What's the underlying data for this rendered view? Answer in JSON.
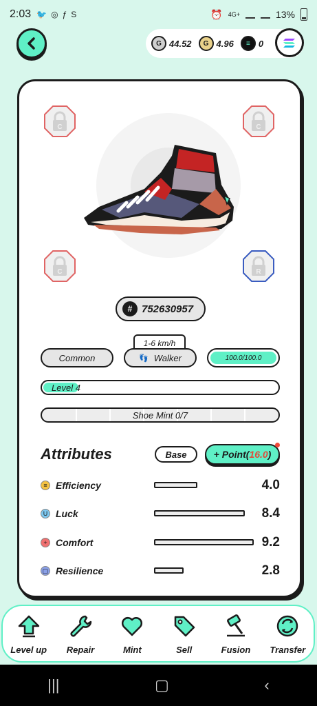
{
  "status_bar": {
    "time": "2:03",
    "battery": "13%",
    "network": "4G+"
  },
  "wallet": {
    "gst": "44.52",
    "gmt": "4.96",
    "sol": "0"
  },
  "sneaker": {
    "id": "752630957",
    "speed_range": "1-6 km/h",
    "rarity": "Common",
    "type": "Walker",
    "durability": "100.0/100.0",
    "level_label": "Level",
    "level": "4",
    "mint_label": "Shoe Mint 0/7",
    "mint_count": 0,
    "mint_max": 7,
    "level_progress": 0.15
  },
  "gem_slots": [
    {
      "name": "top-left",
      "letter": "C"
    },
    {
      "name": "top-right",
      "letter": "C"
    },
    {
      "name": "bottom-left",
      "letter": "C"
    },
    {
      "name": "bottom-right",
      "letter": "R"
    }
  ],
  "attributes": {
    "title": "Attributes",
    "base_label": "Base",
    "point_label": "+ Point(",
    "point_value": "16.0",
    "point_close": ")",
    "items": [
      {
        "name": "Efficiency",
        "icon": "efficiency-icon",
        "glyph": "≡",
        "color": "#f5c242",
        "value": "4.0",
        "fill": 0.19
      },
      {
        "name": "Luck",
        "icon": "luck-icon",
        "glyph": "U",
        "color": "#7ec8f0",
        "value": "8.4",
        "fill": 0.4
      },
      {
        "name": "Comfort",
        "icon": "comfort-icon",
        "glyph": "+",
        "color": "#f07070",
        "value": "9.2",
        "fill": 0.44
      },
      {
        "name": "Resilience",
        "icon": "resilience-icon",
        "glyph": "▢",
        "color": "#8aa0e8",
        "value": "2.8",
        "fill": 0.13
      }
    ]
  },
  "nav": [
    {
      "label": "Level up",
      "icon": "level-up-icon"
    },
    {
      "label": "Repair",
      "icon": "wrench-icon"
    },
    {
      "label": "Mint",
      "icon": "heart-icon"
    },
    {
      "label": "Sell",
      "icon": "tag-icon"
    },
    {
      "label": "Fusion",
      "icon": "hammer-icon"
    },
    {
      "label": "Transfer",
      "icon": "transfer-icon"
    }
  ],
  "colors": {
    "accent": "#5ff0c6",
    "background": "#d8f7ec",
    "outline": "#1b1b1b",
    "points": "#e04a3a"
  }
}
